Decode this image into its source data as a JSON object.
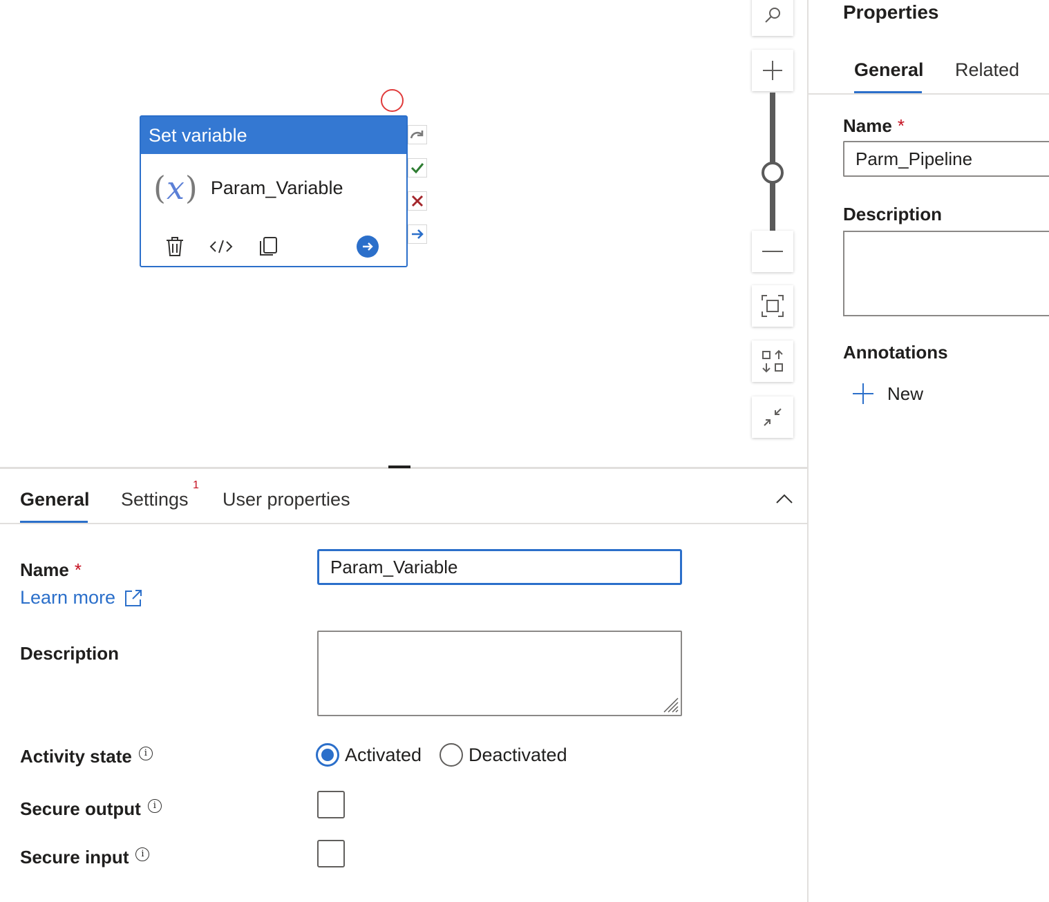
{
  "canvas": {
    "activity": {
      "type_label": "Set variable",
      "name": "Param_Variable",
      "icon_symbol_left": "(",
      "icon_symbol_mid": "x",
      "icon_symbol_right": ")"
    },
    "toolbar": {
      "icons": [
        "search-icon",
        "zoom-in-icon",
        "zoom-slider",
        "zoom-out-icon",
        "fit-to-screen-icon",
        "auto-align-icon",
        "collapse-icon"
      ]
    },
    "colors": {
      "accent": "#2b6fca",
      "header": "#3478d2",
      "success": "#2e7d32",
      "failure": "#a4262c",
      "error_ring": "#e03a3a"
    }
  },
  "bottom_panel": {
    "tabs": [
      {
        "label": "General",
        "active": true
      },
      {
        "label": "Settings",
        "badge": "1"
      },
      {
        "label": "User properties"
      }
    ],
    "name_label": "Name",
    "required_mark": "*",
    "learn_more": "Learn more",
    "name_value": "Param_Variable",
    "description_label": "Description",
    "description_value": "",
    "activity_state_label": "Activity state",
    "activity_state_options": [
      "Activated",
      "Deactivated"
    ],
    "activity_state_selected": "Activated",
    "secure_output_label": "Secure output",
    "secure_input_label": "Secure input",
    "info_glyph": "i"
  },
  "properties_pane": {
    "title": "Properties",
    "tabs": [
      {
        "label": "General",
        "active": true
      },
      {
        "label": "Related"
      }
    ],
    "name_label": "Name",
    "required_mark": "*",
    "name_value": "Parm_Pipeline",
    "description_label": "Description",
    "annotations_label": "Annotations",
    "new_label": "New"
  }
}
